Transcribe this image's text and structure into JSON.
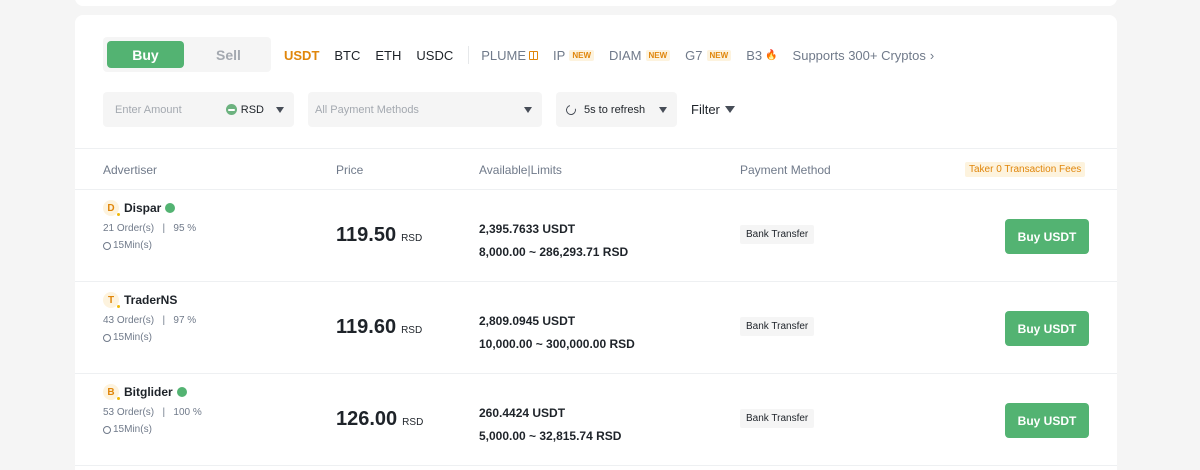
{
  "trade_toggle": {
    "buy": "Buy",
    "sell": "Sell"
  },
  "coins": [
    {
      "label": "USDT",
      "active": true
    },
    {
      "label": "BTC"
    },
    {
      "label": "ETH"
    },
    {
      "label": "USDC"
    },
    {
      "label": "PLUME",
      "icon": "gift-icon"
    },
    {
      "label": "IP",
      "badge": "NEW"
    },
    {
      "label": "DIAM",
      "badge": "NEW"
    },
    {
      "label": "G7",
      "badge": "NEW"
    },
    {
      "label": "B3",
      "icon": "fire-icon"
    }
  ],
  "supports_link": "Supports 300+ Cryptos",
  "filters": {
    "amount_placeholder": "Enter Amount",
    "currency": "RSD",
    "payment_placeholder": "All Payment Methods",
    "refresh": "5s to refresh",
    "filter": "Filter"
  },
  "table": {
    "headers": {
      "advertiser": "Advertiser",
      "price": "Price",
      "available": "Available|Limits",
      "payment": "Payment Method"
    },
    "fees_badge": "Taker 0 Transaction Fees",
    "rows": [
      {
        "initial": "D",
        "name": "Dispar",
        "verified": true,
        "orders": "21 Order(s)",
        "completion": "95 %",
        "time": "15Min(s)",
        "price": "119.50",
        "currency": "RSD",
        "available": "2,395.7633 USDT",
        "limits": "8,000.00 ~ 286,293.71 RSD",
        "method": "Bank Transfer",
        "button": "Buy USDT"
      },
      {
        "initial": "T",
        "name": "TraderNS",
        "verified": false,
        "orders": "43 Order(s)",
        "completion": "97 %",
        "time": "15Min(s)",
        "price": "119.60",
        "currency": "RSD",
        "available": "2,809.0945 USDT",
        "limits": "10,000.00 ~ 300,000.00 RSD",
        "method": "Bank Transfer",
        "button": "Buy USDT"
      },
      {
        "initial": "B",
        "name": "Bitglider",
        "verified": true,
        "orders": "53 Order(s)",
        "completion": "100 %",
        "time": "15Min(s)",
        "price": "126.00",
        "currency": "RSD",
        "available": "260.4424 USDT",
        "limits": "5,000.00 ~ 32,815.74 RSD",
        "method": "Bank Transfer",
        "button": "Buy USDT"
      }
    ]
  },
  "colors": {
    "accent": "#53b372",
    "highlight": "#e0860b"
  }
}
